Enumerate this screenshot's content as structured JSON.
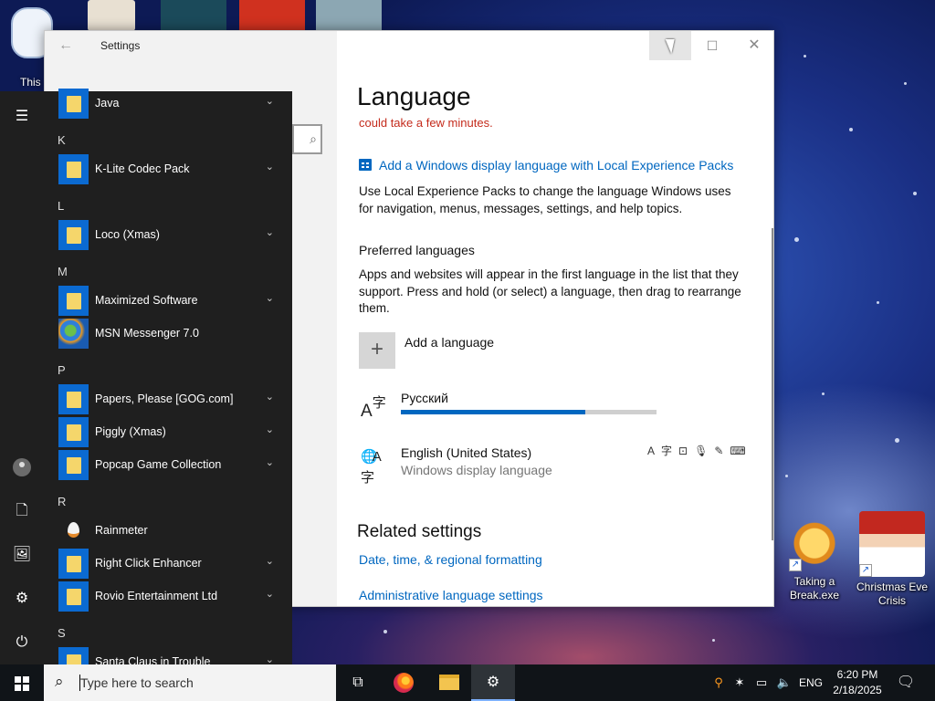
{
  "desktop": {
    "this_pc_label": "This",
    "icons": [
      {
        "label": "Taking a Break.exe",
        "icon": "gear-warning-icon"
      },
      {
        "label": "Christmas Eve Crisis",
        "icon": "santa-icon"
      }
    ]
  },
  "settings_window": {
    "title": "Settings",
    "page_title": "Language",
    "warning": "could take a few minutes.",
    "lep_link": "Add a Windows display language with Local Experience Packs",
    "lep_description": "Use Local Experience Packs to change the language Windows uses for navigation, menus, messages, settings, and help topics.",
    "preferred_heading": "Preferred languages",
    "preferred_description": "Apps and websites will appear in the first language in the list that they support. Press and hold (or select) a language, then drag to rearrange them.",
    "add_language": "Add a language",
    "languages": [
      {
        "name": "Русский",
        "subtitle": "",
        "download_progress": 0.72
      },
      {
        "name": "English (United States)",
        "subtitle": "Windows display language"
      }
    ],
    "related_heading": "Related settings",
    "related_links": [
      "Date, time, & regional formatting",
      "Administrative language settings"
    ]
  },
  "start_menu": {
    "groups": [
      {
        "letter": "",
        "apps": [
          {
            "name": "Java",
            "icon": "folder-icon",
            "expandable": true
          }
        ]
      },
      {
        "letter": "K",
        "apps": [
          {
            "name": "K-Lite Codec Pack",
            "icon": "folder-icon",
            "expandable": true
          }
        ]
      },
      {
        "letter": "L",
        "apps": [
          {
            "name": "Loco (Xmas)",
            "icon": "folder-icon",
            "expandable": true
          }
        ]
      },
      {
        "letter": "M",
        "apps": [
          {
            "name": "Maximized Software",
            "icon": "folder-icon",
            "expandable": true
          },
          {
            "name": "MSN Messenger 7.0",
            "icon": "msn-icon",
            "expandable": false
          }
        ]
      },
      {
        "letter": "P",
        "apps": [
          {
            "name": "Papers, Please [GOG.com]",
            "icon": "folder-icon",
            "expandable": true
          },
          {
            "name": "Piggly (Xmas)",
            "icon": "folder-icon",
            "expandable": true
          },
          {
            "name": "Popcap Game Collection",
            "icon": "folder-icon",
            "expandable": true
          }
        ]
      },
      {
        "letter": "R",
        "apps": [
          {
            "name": "Rainmeter",
            "icon": "rainmeter-drop-icon",
            "expandable": false
          },
          {
            "name": "Right Click Enhancer",
            "icon": "folder-icon",
            "expandable": true
          },
          {
            "name": "Rovio Entertainment Ltd",
            "icon": "folder-icon",
            "expandable": true
          }
        ]
      },
      {
        "letter": "S",
        "apps": [
          {
            "name": "Santa Claus in Trouble",
            "icon": "folder-icon",
            "expandable": true
          }
        ]
      }
    ]
  },
  "taskbar": {
    "search_placeholder": "Type here to search",
    "language": "ENG",
    "time": "6:20 PM",
    "date": "2/18/2025"
  }
}
